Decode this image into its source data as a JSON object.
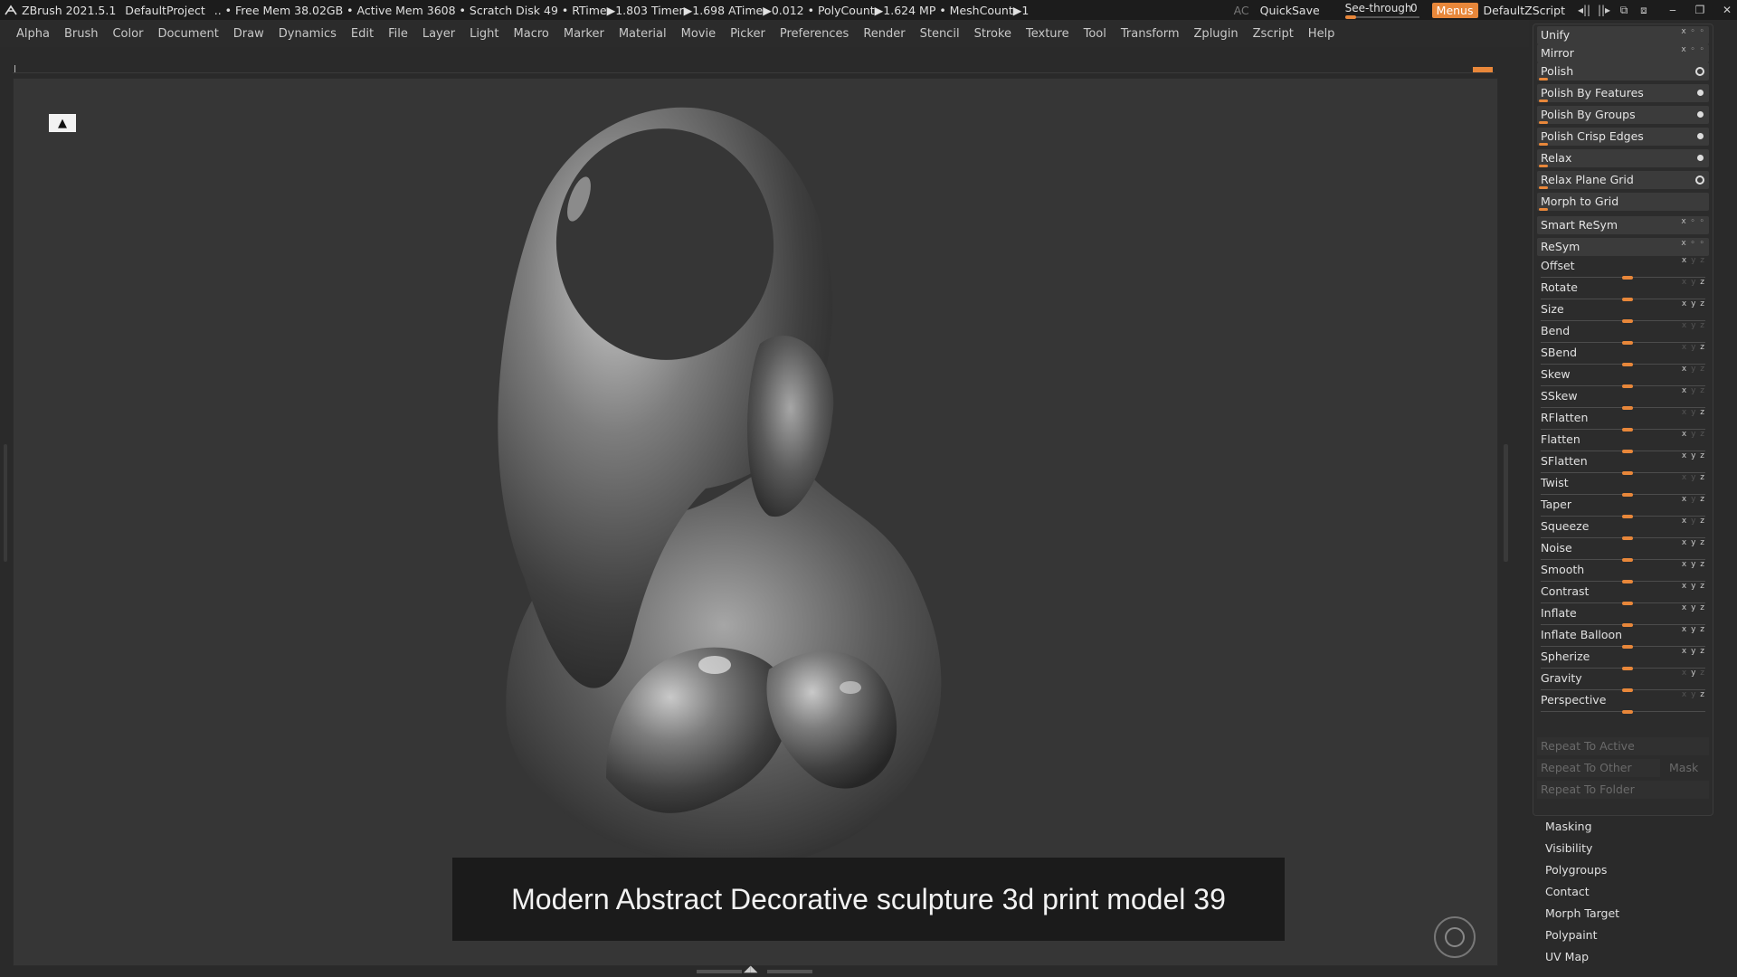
{
  "titlebar": {
    "app": "ZBrush 2021.5.1",
    "project": "DefaultProject",
    "stats": ".. • Free Mem 38.02GB • Active Mem 3608 • Scratch Disk 49 •  RTime▶1.803 Timer▶1.698 ATime▶0.012 • PolyCount▶1.624 MP  • MeshCount▶1",
    "ac": "AC",
    "quicksave": "QuickSave",
    "seethrough_label": "See-through",
    "seethrough_value": "0",
    "menus": "Menus",
    "script": "DefaultZScript"
  },
  "menu": [
    "Alpha",
    "Brush",
    "Color",
    "Document",
    "Draw",
    "Dynamics",
    "Edit",
    "File",
    "Layer",
    "Light",
    "Macro",
    "Marker",
    "Material",
    "Movie",
    "Picker",
    "Preferences",
    "Render",
    "Stencil",
    "Stroke",
    "Texture",
    "Tool",
    "Transform",
    "Zplugin",
    "Zscript",
    "Help"
  ],
  "caption": "Modern Abstract Decorative sculpture 3d print model 39",
  "deformation": {
    "buttons": [
      {
        "label": "Unify",
        "indicator": "xyz"
      },
      {
        "label": "Mirror",
        "indicator": "xyz"
      },
      {
        "label": "Polish",
        "indicator": "ring"
      },
      {
        "label": "Polish By Features",
        "indicator": "dot"
      },
      {
        "label": "Polish By Groups",
        "indicator": "dot"
      },
      {
        "label": "Polish Crisp Edges",
        "indicator": "dot"
      },
      {
        "label": "Relax",
        "indicator": "dot"
      },
      {
        "label": "Relax Plane Grid",
        "indicator": "ring"
      },
      {
        "label": "Morph to Grid",
        "indicator": "none"
      },
      {
        "label": "Smart ReSym",
        "indicator": "xyz"
      },
      {
        "label": "ReSym",
        "indicator": "xyz"
      }
    ],
    "sliders": [
      "Offset",
      "Rotate",
      "Size",
      "Bend",
      "SBend",
      "Skew",
      "SSkew",
      "RFlatten",
      "Flatten",
      "SFlatten",
      "Twist",
      "Taper",
      "Squeeze",
      "Noise",
      "Smooth",
      "Contrast",
      "Inflate",
      "Inflate Balloon",
      "Spherize",
      "Gravity",
      "Perspective"
    ],
    "repeat_active": "Repeat To Active",
    "repeat_other": "Repeat To Other",
    "mask": "Mask",
    "repeat_folder": "Repeat To Folder"
  },
  "subpalettes": [
    "Masking",
    "Visibility",
    "Polygroups",
    "Contact",
    "Morph Target",
    "Polypaint",
    "UV Map"
  ],
  "colors": {
    "accent": "#e8873a",
    "background": "#2a2a2a",
    "viewport": "#363636"
  }
}
